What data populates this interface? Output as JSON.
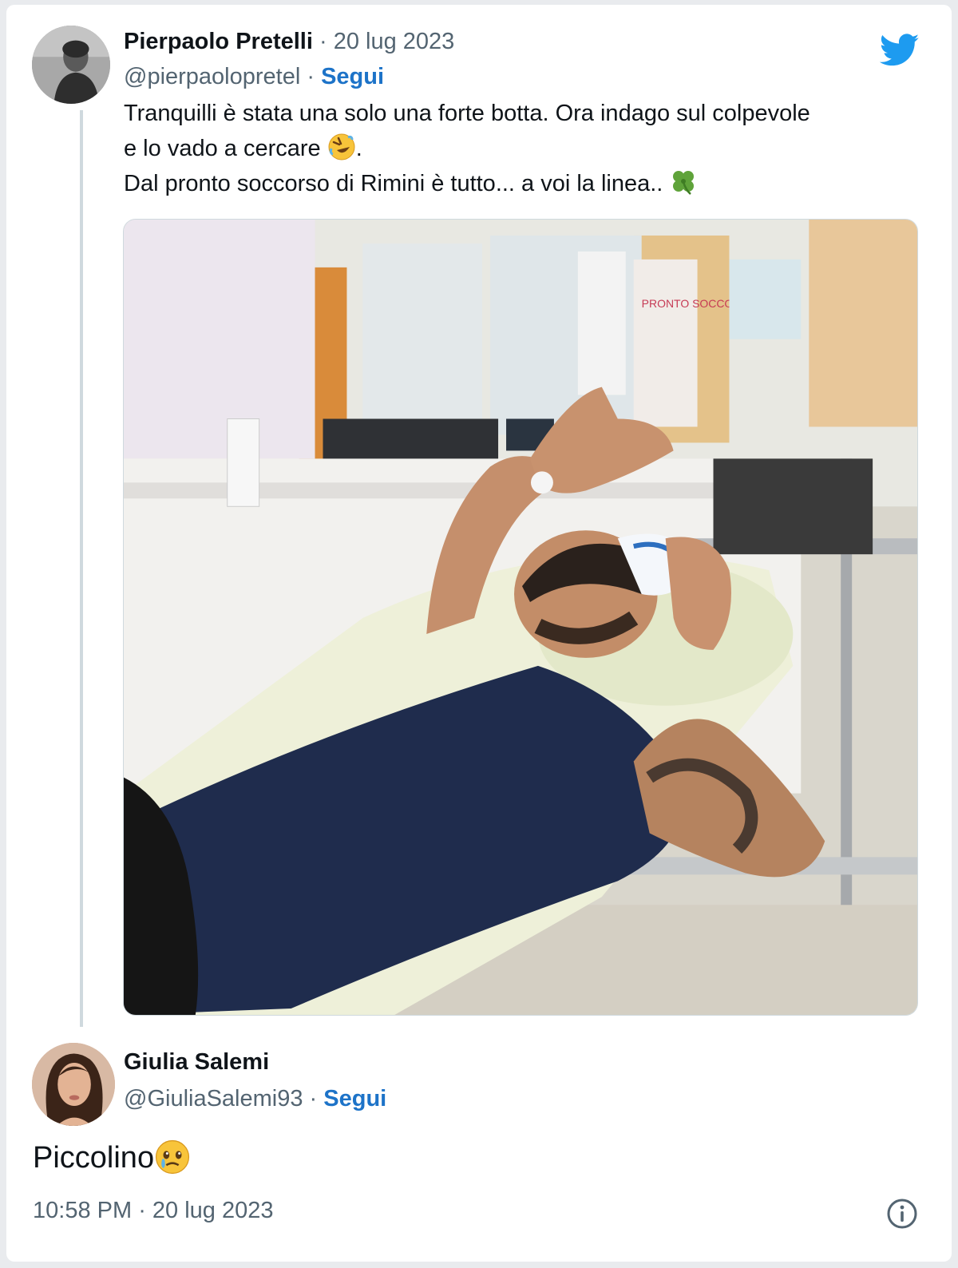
{
  "tweet": {
    "author_name": "Pierpaolo Pretelli",
    "separator": " · ",
    "date": "20 lug 2023",
    "handle": "@pierpaolopretel",
    "follow_separator": " · ",
    "follow_label": "Segui",
    "text_line1": "Tranquilli è stata una solo una forte botta. Ora indago sul colpevole",
    "text_line2": "e lo vado a cercare ",
    "text_line2_end": ".",
    "text_line3": "Dal pronto soccorso di Rimini è tutto... a voi la linea.. ",
    "emoji1": "rolling-on-floor-laughing-emoji",
    "emoji2": "four-leaf-clover-emoji",
    "photo_description_icon": "hospital-photo"
  },
  "reply": {
    "author_name": "Giulia Salemi",
    "handle": "@GiuliaSalemi93",
    "follow_separator": " · ",
    "follow_label": "Segui",
    "text": "Piccolino",
    "emoji": "face-holding-back-tears-emoji"
  },
  "footer": {
    "time": "10:58 PM",
    "separator": " · ",
    "date": "20 lug 2023",
    "info_icon": "info-icon"
  },
  "colors": {
    "link_blue": "#1d73c8",
    "twitter_blue": "#1d9bf0",
    "secondary_text": "#536471",
    "thread_line": "#cfd9de"
  }
}
